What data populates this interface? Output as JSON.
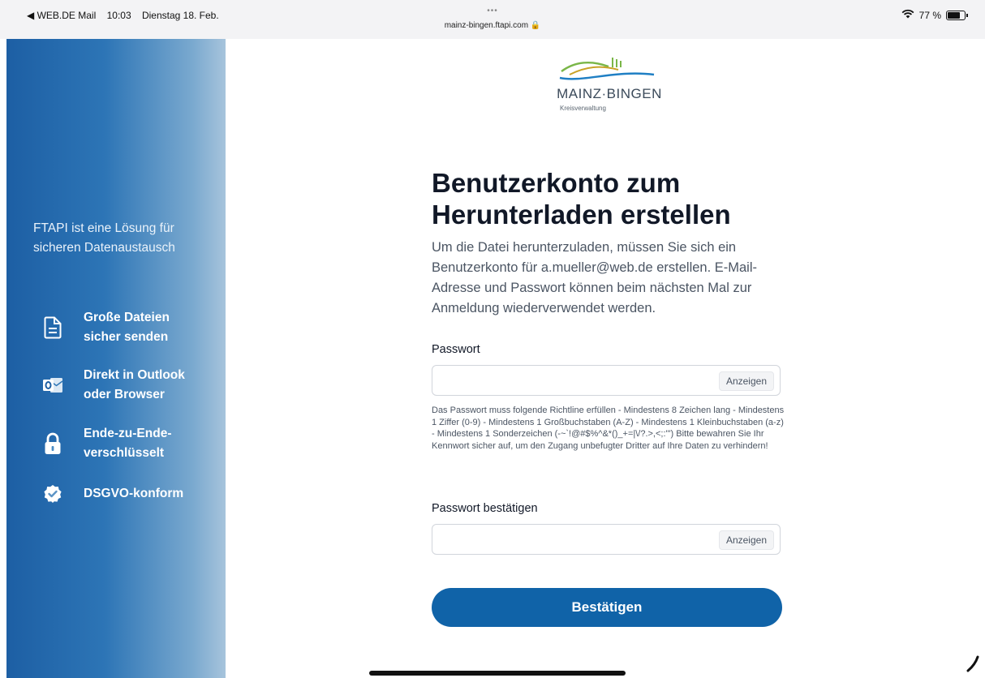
{
  "statusbar": {
    "back_app": "◀ WEB.DE Mail",
    "time": "10:03",
    "date": "Dienstag 18. Feb.",
    "url": "mainz-bingen.ftapi.com 🔒",
    "dots": "•••",
    "battery": "77 %",
    "wifi_icon": "wifi-icon"
  },
  "sidebar": {
    "tagline": "FTAPI ist eine Lösung für sicheren Datenaustausch",
    "features": [
      {
        "label": "Große Dateien sicher senden",
        "icon": "document-icon"
      },
      {
        "label": "Direkt in Outlook oder Browser",
        "icon": "outlook-icon"
      },
      {
        "label": "Ende-zu-Ende-verschlüsselt",
        "icon": "lock-icon"
      },
      {
        "label": "DSGVO-konform",
        "icon": "shield-check-icon"
      }
    ]
  },
  "logo": {
    "name": "MAINZ·BINGEN",
    "subtitle": "Kreisverwaltung"
  },
  "form": {
    "title": "Benutzerkonto zum Herunterladen erstellen",
    "intro": "Um die Datei herunterzuladen, müssen Sie sich ein Benutzerkonto für a.mueller@web.de erstellen. E-Mail-Adresse und Passwort können beim nächsten Mal zur Anmeldung wiederverwendet werden.",
    "password_label": "Passwort",
    "password_value": "",
    "show_label": "Anzeigen",
    "hint": "Das Passwort muss folgende Richtline erfüllen - Mindestens 8 Zeichen lang - Mindestens 1 Ziffer (0-9) - Mindestens 1 Großbuchstaben (A-Z) - Mindestens 1 Kleinbuchstaben (a-z) - Mindestens 1 Sonderzeichen (-~`!@#$%^&*()_+=|\\/?.>,<;:'\") Bitte bewahren Sie Ihr Kennwort sicher auf, um den Zugang unbefugter Dritter auf Ihre Daten zu verhindern!",
    "confirm_label": "Passwort bestätigen",
    "confirm_value": "",
    "confirm_show_label": "Anzeigen",
    "submit_label": "Bestätigen"
  },
  "colors": {
    "primary": "#1063a8",
    "sidebar_start": "#1d5fa4",
    "sidebar_end": "#a7c4dc"
  }
}
